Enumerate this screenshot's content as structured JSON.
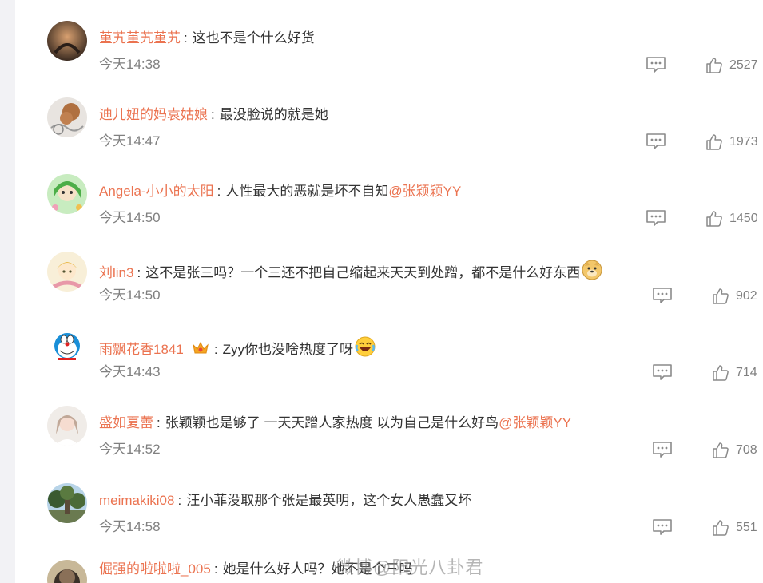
{
  "colors": {
    "username": "#eb7350",
    "text": "#333333",
    "meta": "#808080",
    "background": "#f2f2f5"
  },
  "comments": [
    {
      "user": "堇艽堇艽堇艽",
      "text": "这也不是个什么好货",
      "mention": "",
      "time": "今天14:38",
      "likes": "2527",
      "reply_icon": "comment-icon",
      "like_icon": "thumbs-up-icon",
      "avatar": "dark-photo"
    },
    {
      "user": "迪儿妞的妈袁姑娘",
      "text": "最没脸说的就是她",
      "mention": "",
      "time": "今天14:47",
      "likes": "1973",
      "reply_icon": "comment-icon",
      "like_icon": "thumbs-up-icon",
      "avatar": "dog-photo"
    },
    {
      "user": "Angela-小小的太阳",
      "text": "人性最大的恶就是坏不自知",
      "mention": "@张颖颖YY",
      "time": "今天14:50",
      "likes": "1450",
      "reply_icon": "comment-icon",
      "like_icon": "thumbs-up-icon",
      "avatar": "green-cartoon"
    },
    {
      "user": "刘lin3",
      "text": "这不是张三吗？一个三还不把自己缩起来天天到处蹭，都不是什么好东西",
      "mention": "",
      "time": "今天14:50",
      "likes": "902",
      "reply_icon": "comment-icon",
      "like_icon": "thumbs-up-icon",
      "avatar": "yellow-cartoon",
      "emoji": "doge-emoji"
    },
    {
      "user": "雨飘花香1841",
      "text": "Zyy你也没啥热度了呀",
      "mention": "",
      "time": "今天14:43",
      "likes": "714",
      "reply_icon": "comment-icon",
      "like_icon": "thumbs-up-icon",
      "avatar": "doraemon",
      "emoji": "laughing-emoji",
      "badge": "crown-badge-icon"
    },
    {
      "user": "盛如夏蕾",
      "text": "张颖颖也是够了 一天天蹭人家热度 以为自己是什么好鸟",
      "mention": "@张颖颖YY",
      "time": "今天14:52",
      "likes": "708",
      "reply_icon": "comment-icon",
      "like_icon": "thumbs-up-icon",
      "avatar": "light-photo"
    },
    {
      "user": "meimakiki08",
      "text": "汪小菲没取那个张是最英明，这个女人愚蠢又坏",
      "mention": "",
      "time": "今天14:58",
      "likes": "551",
      "reply_icon": "comment-icon",
      "like_icon": "thumbs-up-icon",
      "avatar": "tree-photo"
    },
    {
      "user": "倔强的啦啦啦_005",
      "text": "她是什么好人吗？她不是个三吗",
      "mention": "",
      "time": "",
      "likes": "",
      "reply_icon": "comment-icon",
      "like_icon": "thumbs-up-icon",
      "avatar": "dark-round"
    }
  ],
  "watermark": "微博@阳光八卦君"
}
